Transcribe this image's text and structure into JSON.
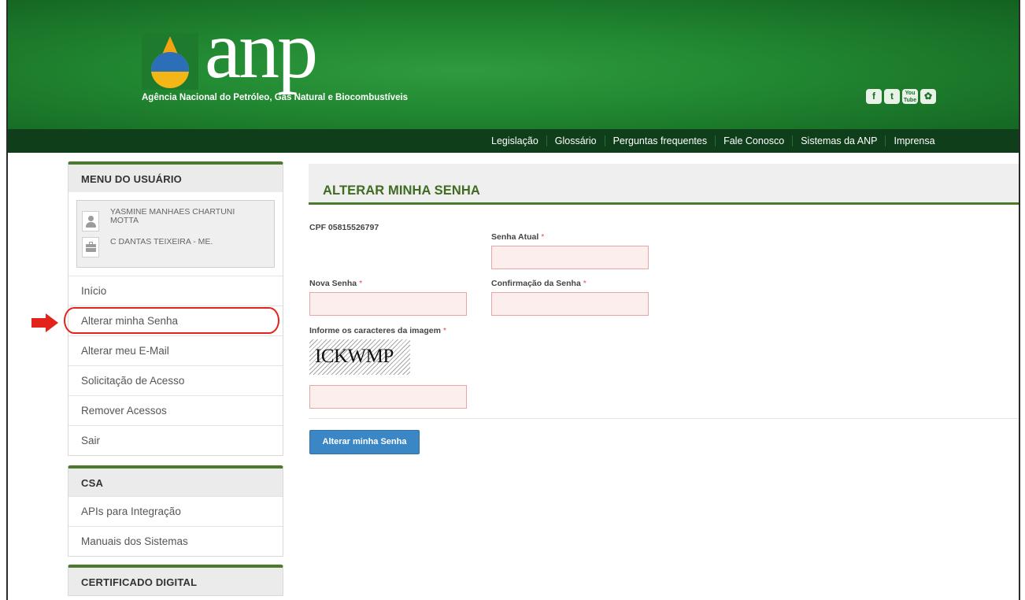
{
  "header": {
    "logo_text": "anp",
    "agency_name": "Agência Nacional do Petróleo, Gás Natural e Biocombustíveis",
    "social": [
      "f",
      "t",
      "You Tube",
      "flickr"
    ],
    "colors": {
      "header_green": "#238b33",
      "nav_dark_green": "#0f3f1a"
    }
  },
  "topnav": {
    "items": [
      "Legislação",
      "Glossário",
      "Perguntas frequentes",
      "Fale Conosco",
      "Sistemas da ANP",
      "Imprensa"
    ]
  },
  "user_menu": {
    "title": "MENU DO USUÁRIO",
    "user_name": "YASMINE MANHAES CHARTUNI MOTTA",
    "company": "C DANTAS TEIXEIRA - ME.",
    "items": [
      "Início",
      "Alterar minha Senha",
      "Alterar meu E-Mail",
      "Solicitação de Acesso",
      "Remover Acessos",
      "Sair"
    ],
    "highlighted_item": "Alterar minha Senha"
  },
  "csa_menu": {
    "title": "CSA",
    "items": [
      "APIs para Integração",
      "Manuais dos Sistemas"
    ]
  },
  "cert_menu": {
    "title": "CERTIFICADO DIGITAL"
  },
  "form": {
    "title": "ALTERAR MINHA SENHA",
    "cpf": "CPF 05815526797",
    "current_password_label": "Senha Atual",
    "new_password_label": "Nova Senha",
    "confirm_password_label": "Confirmação da Senha",
    "captcha_label": "Informe os caracteres da imagem",
    "captcha_text": "ICKWMP",
    "required_mark": "*",
    "submit_label": "Alterar minha Senha",
    "colors": {
      "accent_green": "#4c7a2d",
      "button_blue": "#3b86c4",
      "invalid_field": "#fdeeee"
    }
  }
}
